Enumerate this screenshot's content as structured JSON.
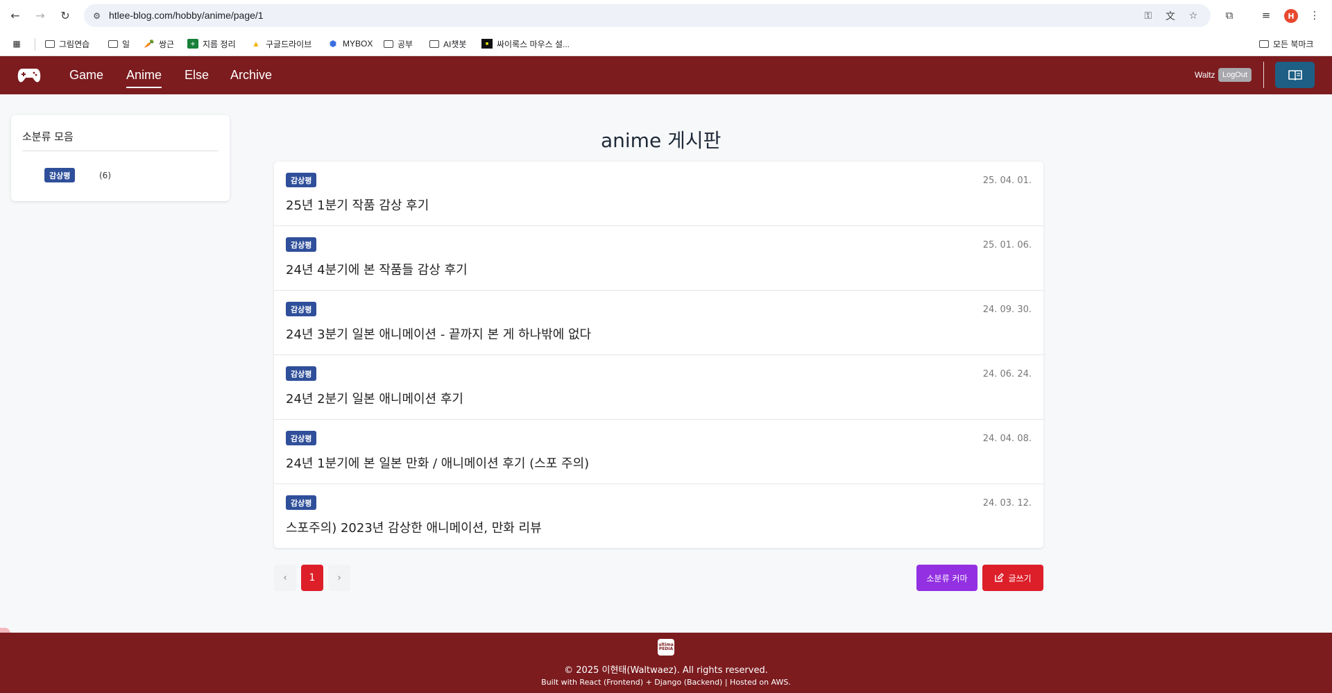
{
  "browser": {
    "url": "htlee-blog.com/hobby/anime/page/1",
    "profile_initial": "H",
    "bookmarks": [
      {
        "label": "그림연습",
        "icon": "folder-icon"
      },
      {
        "label": "일",
        "icon": "folder-icon"
      },
      {
        "label": "쌍근",
        "icon": "carrot-icon"
      },
      {
        "label": "지름 정리",
        "icon": "sheets-icon"
      },
      {
        "label": "구글드라이브",
        "icon": "drive-icon"
      },
      {
        "label": "MYBOX",
        "icon": "mybox-icon"
      },
      {
        "label": "공부",
        "icon": "folder-icon"
      },
      {
        "label": "AI챗봇",
        "icon": "folder-icon"
      },
      {
        "label": "싸이록스 마우스 설...",
        "icon": "site-icon"
      }
    ],
    "all_bookmarks": "모든 북마크"
  },
  "header": {
    "menu": [
      "Game",
      "Anime",
      "Else",
      "Archive"
    ],
    "active_menu": "Anime",
    "user": "Waltz",
    "logout": "LogOut",
    "accent": "#7c1c1f"
  },
  "sidebar": {
    "title": "소분류 모음",
    "category": "감상평",
    "count": "(6)"
  },
  "board": {
    "title": "anime 게시판",
    "posts": [
      {
        "badge": "감상평",
        "date": "25. 04. 01.",
        "title": "25년 1분기 작품 감상 후기"
      },
      {
        "badge": "감상평",
        "date": "25. 01. 06.",
        "title": "24년 4분기에 본 작품들 감상 후기"
      },
      {
        "badge": "감상평",
        "date": "24. 09. 30.",
        "title": "24년 3분기 일본 애니메이션 - 끝까지 본 게 하나밖에 없다"
      },
      {
        "badge": "감상평",
        "date": "24. 06. 24.",
        "title": "24년 2분기 일본 애니메이션 후기"
      },
      {
        "badge": "감상평",
        "date": "24. 04. 08.",
        "title": "24년 1분기에 본 일본 만화 / 애니메이션 후기 (스포 주의)"
      },
      {
        "badge": "감상평",
        "date": "24. 03. 12.",
        "title": "스포주의) 2023년 감상한 애니메이션, 만화 리뷰"
      }
    ],
    "pager": {
      "prev": "‹",
      "current": "1",
      "next": "›"
    },
    "category_button": "소분류 커마",
    "write_button": "글쓰기"
  },
  "footer": {
    "logo_text": "ultima PEDIA",
    "copyright": "© 2025 이현태(Waltwaez). All rights reserved.",
    "built_with": "Built with React (Frontend) + Django (Backend) | Hosted on AWS."
  }
}
